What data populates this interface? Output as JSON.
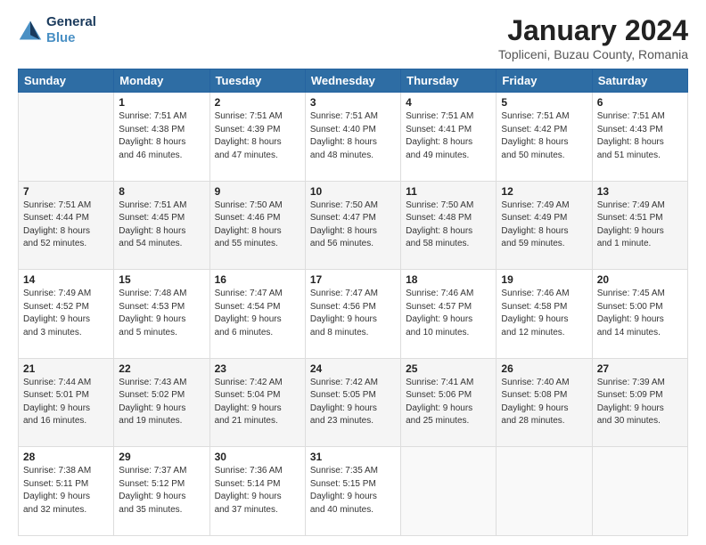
{
  "logo": {
    "line1": "General",
    "line2": "Blue"
  },
  "title": "January 2024",
  "subtitle": "Topliceni, Buzau County, Romania",
  "weekdays": [
    "Sunday",
    "Monday",
    "Tuesday",
    "Wednesday",
    "Thursday",
    "Friday",
    "Saturday"
  ],
  "weeks": [
    [
      {
        "day": "",
        "info": ""
      },
      {
        "day": "1",
        "info": "Sunrise: 7:51 AM\nSunset: 4:38 PM\nDaylight: 8 hours\nand 46 minutes."
      },
      {
        "day": "2",
        "info": "Sunrise: 7:51 AM\nSunset: 4:39 PM\nDaylight: 8 hours\nand 47 minutes."
      },
      {
        "day": "3",
        "info": "Sunrise: 7:51 AM\nSunset: 4:40 PM\nDaylight: 8 hours\nand 48 minutes."
      },
      {
        "day": "4",
        "info": "Sunrise: 7:51 AM\nSunset: 4:41 PM\nDaylight: 8 hours\nand 49 minutes."
      },
      {
        "day": "5",
        "info": "Sunrise: 7:51 AM\nSunset: 4:42 PM\nDaylight: 8 hours\nand 50 minutes."
      },
      {
        "day": "6",
        "info": "Sunrise: 7:51 AM\nSunset: 4:43 PM\nDaylight: 8 hours\nand 51 minutes."
      }
    ],
    [
      {
        "day": "7",
        "info": "Sunrise: 7:51 AM\nSunset: 4:44 PM\nDaylight: 8 hours\nand 52 minutes."
      },
      {
        "day": "8",
        "info": "Sunrise: 7:51 AM\nSunset: 4:45 PM\nDaylight: 8 hours\nand 54 minutes."
      },
      {
        "day": "9",
        "info": "Sunrise: 7:50 AM\nSunset: 4:46 PM\nDaylight: 8 hours\nand 55 minutes."
      },
      {
        "day": "10",
        "info": "Sunrise: 7:50 AM\nSunset: 4:47 PM\nDaylight: 8 hours\nand 56 minutes."
      },
      {
        "day": "11",
        "info": "Sunrise: 7:50 AM\nSunset: 4:48 PM\nDaylight: 8 hours\nand 58 minutes."
      },
      {
        "day": "12",
        "info": "Sunrise: 7:49 AM\nSunset: 4:49 PM\nDaylight: 8 hours\nand 59 minutes."
      },
      {
        "day": "13",
        "info": "Sunrise: 7:49 AM\nSunset: 4:51 PM\nDaylight: 9 hours\nand 1 minute."
      }
    ],
    [
      {
        "day": "14",
        "info": "Sunrise: 7:49 AM\nSunset: 4:52 PM\nDaylight: 9 hours\nand 3 minutes."
      },
      {
        "day": "15",
        "info": "Sunrise: 7:48 AM\nSunset: 4:53 PM\nDaylight: 9 hours\nand 5 minutes."
      },
      {
        "day": "16",
        "info": "Sunrise: 7:47 AM\nSunset: 4:54 PM\nDaylight: 9 hours\nand 6 minutes."
      },
      {
        "day": "17",
        "info": "Sunrise: 7:47 AM\nSunset: 4:56 PM\nDaylight: 9 hours\nand 8 minutes."
      },
      {
        "day": "18",
        "info": "Sunrise: 7:46 AM\nSunset: 4:57 PM\nDaylight: 9 hours\nand 10 minutes."
      },
      {
        "day": "19",
        "info": "Sunrise: 7:46 AM\nSunset: 4:58 PM\nDaylight: 9 hours\nand 12 minutes."
      },
      {
        "day": "20",
        "info": "Sunrise: 7:45 AM\nSunset: 5:00 PM\nDaylight: 9 hours\nand 14 minutes."
      }
    ],
    [
      {
        "day": "21",
        "info": "Sunrise: 7:44 AM\nSunset: 5:01 PM\nDaylight: 9 hours\nand 16 minutes."
      },
      {
        "day": "22",
        "info": "Sunrise: 7:43 AM\nSunset: 5:02 PM\nDaylight: 9 hours\nand 19 minutes."
      },
      {
        "day": "23",
        "info": "Sunrise: 7:42 AM\nSunset: 5:04 PM\nDaylight: 9 hours\nand 21 minutes."
      },
      {
        "day": "24",
        "info": "Sunrise: 7:42 AM\nSunset: 5:05 PM\nDaylight: 9 hours\nand 23 minutes."
      },
      {
        "day": "25",
        "info": "Sunrise: 7:41 AM\nSunset: 5:06 PM\nDaylight: 9 hours\nand 25 minutes."
      },
      {
        "day": "26",
        "info": "Sunrise: 7:40 AM\nSunset: 5:08 PM\nDaylight: 9 hours\nand 28 minutes."
      },
      {
        "day": "27",
        "info": "Sunrise: 7:39 AM\nSunset: 5:09 PM\nDaylight: 9 hours\nand 30 minutes."
      }
    ],
    [
      {
        "day": "28",
        "info": "Sunrise: 7:38 AM\nSunset: 5:11 PM\nDaylight: 9 hours\nand 32 minutes."
      },
      {
        "day": "29",
        "info": "Sunrise: 7:37 AM\nSunset: 5:12 PM\nDaylight: 9 hours\nand 35 minutes."
      },
      {
        "day": "30",
        "info": "Sunrise: 7:36 AM\nSunset: 5:14 PM\nDaylight: 9 hours\nand 37 minutes."
      },
      {
        "day": "31",
        "info": "Sunrise: 7:35 AM\nSunset: 5:15 PM\nDaylight: 9 hours\nand 40 minutes."
      },
      {
        "day": "",
        "info": ""
      },
      {
        "day": "",
        "info": ""
      },
      {
        "day": "",
        "info": ""
      }
    ]
  ]
}
